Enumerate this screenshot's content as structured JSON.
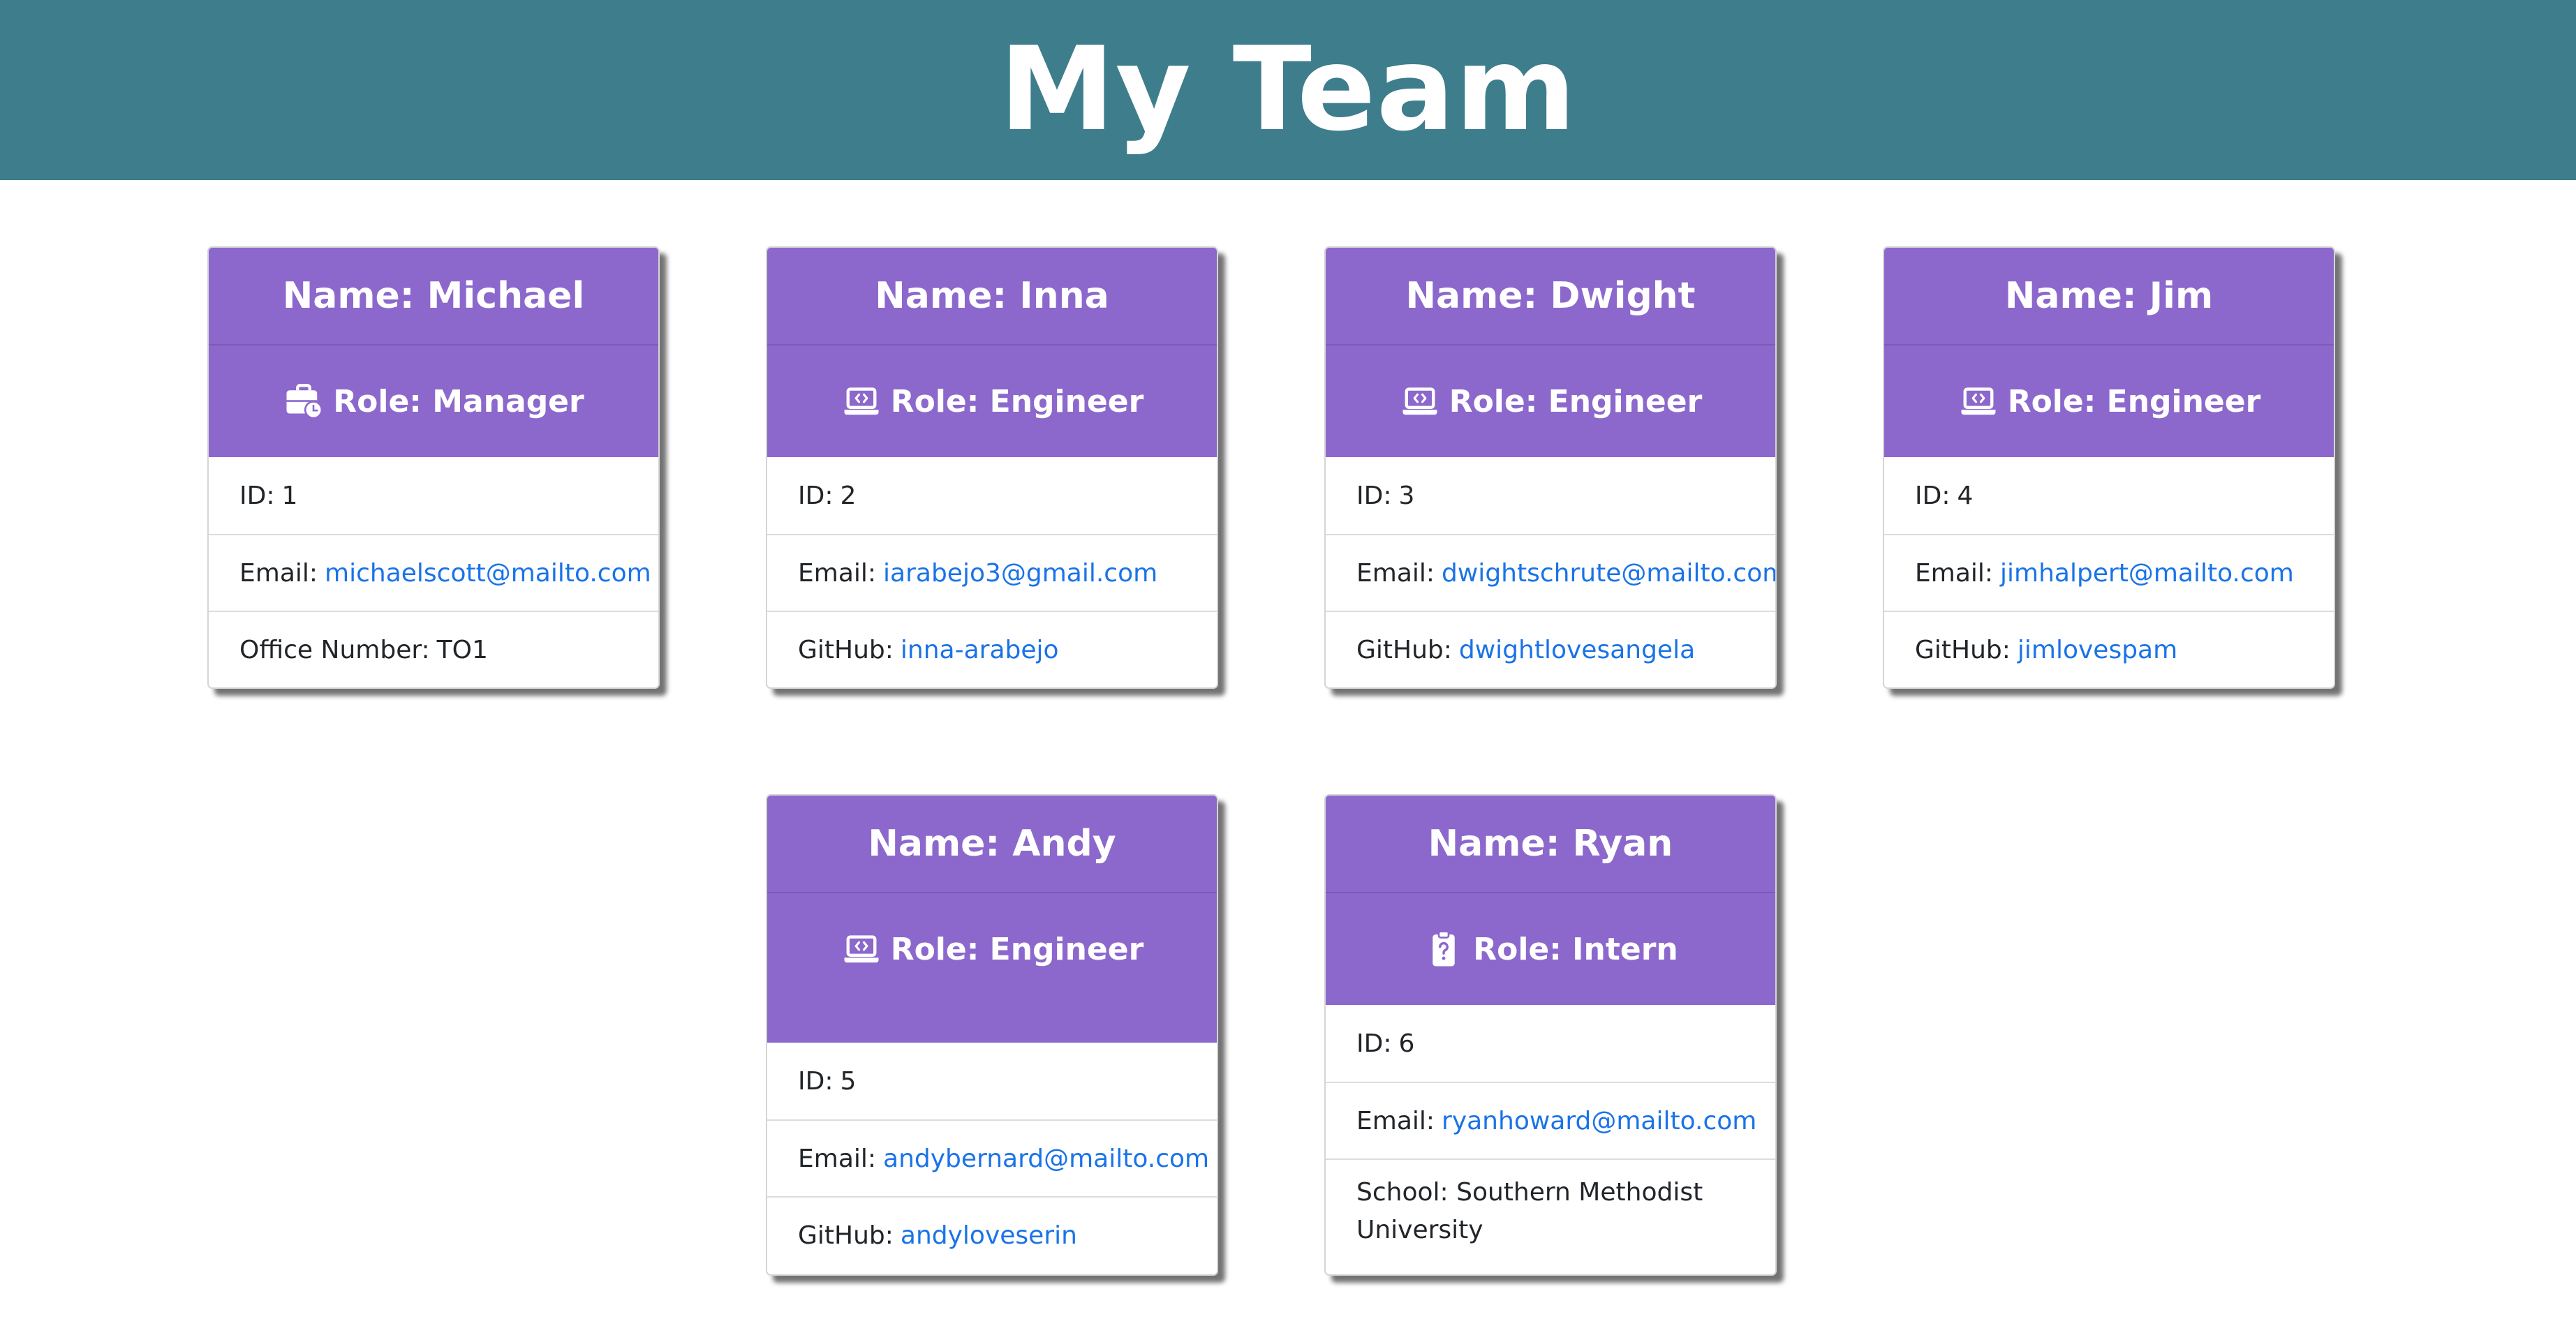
{
  "page": {
    "title": "My Team",
    "header_color": "#3e7d8c",
    "card_header_color": "#8c68cd",
    "link_color": "#1a73e8"
  },
  "cards": [
    {
      "name": "Name: Michael",
      "role": "Role: Manager",
      "icon": "briefcase-clock-icon",
      "id_label": "ID:",
      "id_value": "1",
      "email_label": "Email:",
      "email_value": "michaelscott@mailto.com",
      "extra_label": "Office Number:",
      "extra_value": "TO1"
    },
    {
      "name": "Name: Inna",
      "role": "Role: Engineer",
      "icon": "laptop-code-icon",
      "id_label": "ID:",
      "id_value": "2",
      "email_label": "Email:",
      "email_value": "iarabejo3@gmail.com",
      "extra_label": "GitHub:",
      "extra_value": "inna-arabejo"
    },
    {
      "name": "Name: Dwight",
      "role": "Role: Engineer",
      "icon": "laptop-code-icon",
      "id_label": "ID:",
      "id_value": "3",
      "email_label": "Email:",
      "email_value": "dwightschrute@mailto.com",
      "extra_label": "GitHub:",
      "extra_value": "dwightlovesangela"
    },
    {
      "name": "Name: Jim",
      "role": "Role: Engineer",
      "icon": "laptop-code-icon",
      "id_label": "ID:",
      "id_value": "4",
      "email_label": "Email:",
      "email_value": "jimhalpert@mailto.com",
      "extra_label": "GitHub:",
      "extra_value": "jimlovespam"
    },
    {
      "name": "Name: Andy",
      "role": "Role: Engineer",
      "icon": "laptop-code-icon",
      "id_label": "ID:",
      "id_value": "5",
      "email_label": "Email:",
      "email_value": "andybernard@mailto.com",
      "extra_label": "GitHub:",
      "extra_value": "andyloveserin"
    },
    {
      "name": "Name: Ryan",
      "role": "Role: Intern",
      "icon": "clipboard-question-icon",
      "id_label": "ID:",
      "id_value": "6",
      "email_label": "Email:",
      "email_value": "ryanhoward@mailto.com",
      "extra_label": "School:",
      "extra_value": "Southern Methodist University"
    }
  ]
}
